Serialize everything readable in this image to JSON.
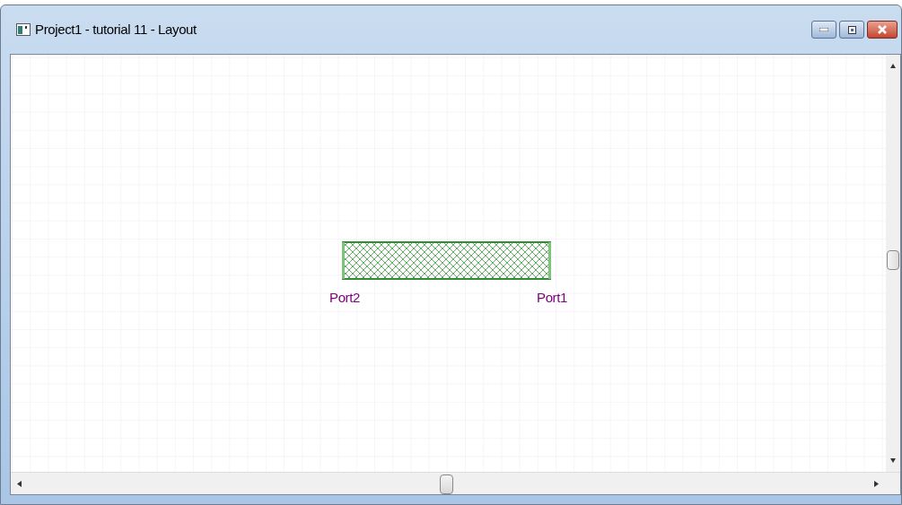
{
  "window": {
    "title": "Project1 - tutorial 11 - Layout"
  },
  "layout": {
    "ports": [
      {
        "label": "Port2"
      },
      {
        "label": "Port1"
      }
    ]
  }
}
